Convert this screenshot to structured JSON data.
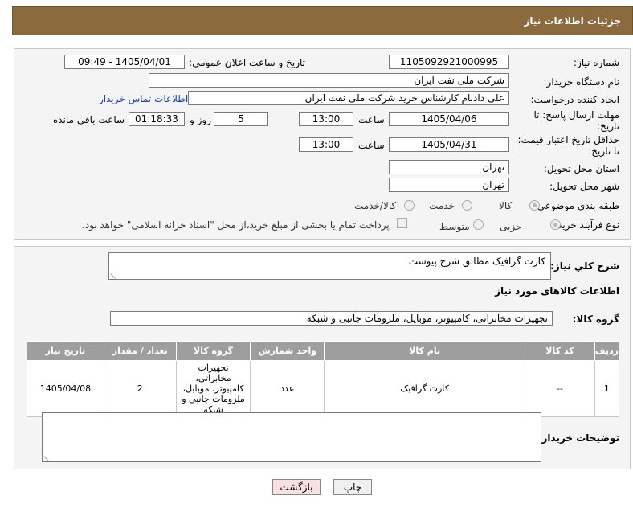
{
  "header": {
    "title": "جزئیات اطلاعات نیاز"
  },
  "form": {
    "need_number_label": "شماره نیاز:",
    "need_number": "1105092921000995",
    "announce_label": "تاریخ و ساعت اعلان عمومی:",
    "announce_value": "1405/04/01 - 09:49",
    "buyer_org_label": "نام دستگاه خریدار:",
    "buyer_org": "شرکت ملی نفت ایران",
    "creator_label": "ایجاد کننده درخواست:",
    "creator": "علی دادبام کارشناس خرید شرکت ملی نفت ایران",
    "contact_link": "اطلاعات تماس خریدار",
    "deadline_label": "مهلت ارسال پاسخ: تا تاریخ:",
    "deadline_date": "1405/04/06",
    "time_label": "ساعت",
    "deadline_time": "13:00",
    "days_value": "5",
    "days_label": "روز و",
    "remaining_time": "01:18:33",
    "remaining_label": "ساعت باقی مانده",
    "validity_label": "حداقل تاریخ اعتبار قیمت: تا تاریخ:",
    "validity_date": "1405/04/31",
    "validity_time": "13:00",
    "province_label": "استان محل تحویل:",
    "province": "تهران",
    "city_label": "شهر محل تحویل:",
    "city": "تهران",
    "category_label": "طبقه بندی موضوعی:",
    "category_options": [
      "کالا",
      "خدمت",
      "کالا/خدمت"
    ],
    "purchase_type_label": "نوع فرآیند خرید :",
    "purchase_options": [
      "جزیی",
      "متوسط"
    ],
    "payment_note": "پرداخت تمام یا بخشی از مبلغ خرید،از محل \"اسناد خزانه اسلامی\" خواهد بود."
  },
  "details": {
    "summary_label": "شرح کلي نياز:",
    "summary_value": "کارت گرافیک مطابق شرح پیوست",
    "goods_info_title": "اطلاعات کالاهای مورد نیاز",
    "goods_group_label": "گروه کالا:",
    "goods_group_value": "تجهیزات مخابراتی، کامپیوتر، موبایل، ملزومات جانبی و شبکه",
    "table": {
      "columns": [
        "ردیف",
        "کد کالا",
        "نام کالا",
        "واحد شمارش",
        "گروه کالا",
        "تعداد / مقدار",
        "تاریخ نیاز"
      ],
      "rows": [
        [
          "1",
          "--",
          "کارت گرافیک",
          "عدد",
          "تجهیزات مخابراتی، کامپیوتر، موبایل، ملزومات جانبی و شبکه",
          "2",
          "1405/04/08"
        ]
      ]
    },
    "buyer_notes_label": "توضیحات خریدار:"
  },
  "buttons": {
    "print": "چاپ",
    "back": "بازگشت"
  }
}
